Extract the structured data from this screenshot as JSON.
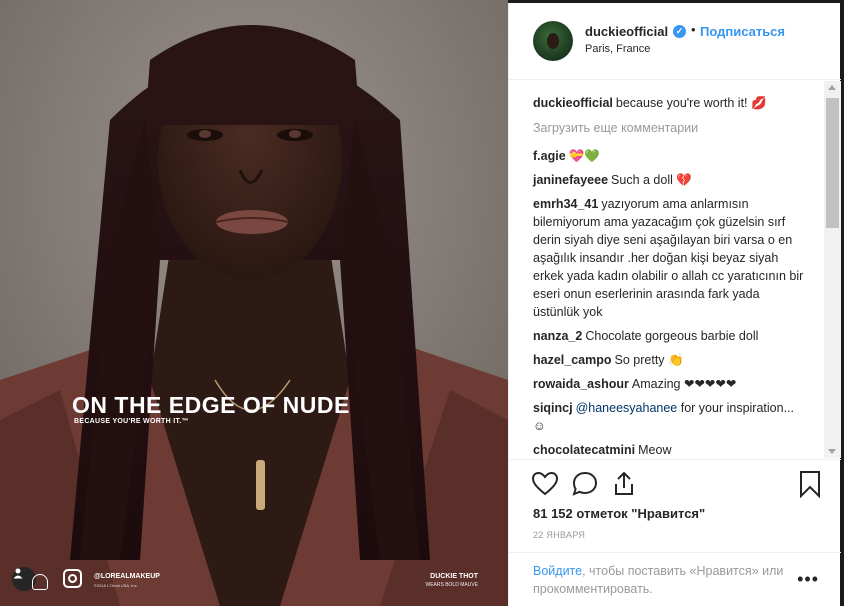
{
  "ad": {
    "title": "ON THE EDGE OF NUDE",
    "subtitle": "BECAUSE YOU'RE WORTH IT.™",
    "brand_handle": "@LOREALMAKEUP",
    "brand_copy": "©2018 L'Oréal USA, Inc.",
    "model_name": "DUCKIE THOT",
    "model_wear": "WEARS BOLD MAUVE"
  },
  "header": {
    "username": "duckieofficial",
    "verified": "✓",
    "separator": "•",
    "follow_label": "Подписаться",
    "location": "Paris, France"
  },
  "comments": {
    "load_more": "Загрузить еще комментарии",
    "items": [
      {
        "user": "duckieofficial",
        "text": "because you're worth it! 💋"
      },
      {
        "user": "f.agie",
        "text": "💝💚"
      },
      {
        "user": "janinefayeee",
        "text": "Such a doll 💔"
      },
      {
        "user": "emrh34_41",
        "text": "yazıyorum ama anlarmısın bilemiyorum ama yazacağım çok güzelsin sırf derin siyah diye seni aşağılayan biri varsa o en aşağılık insandır .her doğan kişi beyaz siyah erkek yada kadın olabilir o allah cc yaratıcının bir eseri onun eserlerinin arasında fark yada üstünlük yok"
      },
      {
        "user": "nanza_2",
        "text": "Chocolate gorgeous barbie doll"
      },
      {
        "user": "hazel_campo",
        "text": "So pretty 👏"
      },
      {
        "user": "rowaida_ashour",
        "text": "Amazing ❤❤❤❤❤"
      },
      {
        "user": "siqincj",
        "mention": "@haneesyahanee",
        "text": "for your inspiration...☺"
      },
      {
        "user": "chocolatecatmini",
        "text": "Meow"
      }
    ]
  },
  "actions": {
    "likes": "81 152 отметок \"Нравится\"",
    "date": "22 ЯНВАРЯ",
    "login_link": "Войдите",
    "login_rest": ", чтобы поставить «Нравится» или прокомментировать.",
    "more": "•••"
  },
  "colors": {
    "accent": "#3897f0",
    "text": "#262626",
    "muted": "#999999",
    "border": "#efefef"
  }
}
